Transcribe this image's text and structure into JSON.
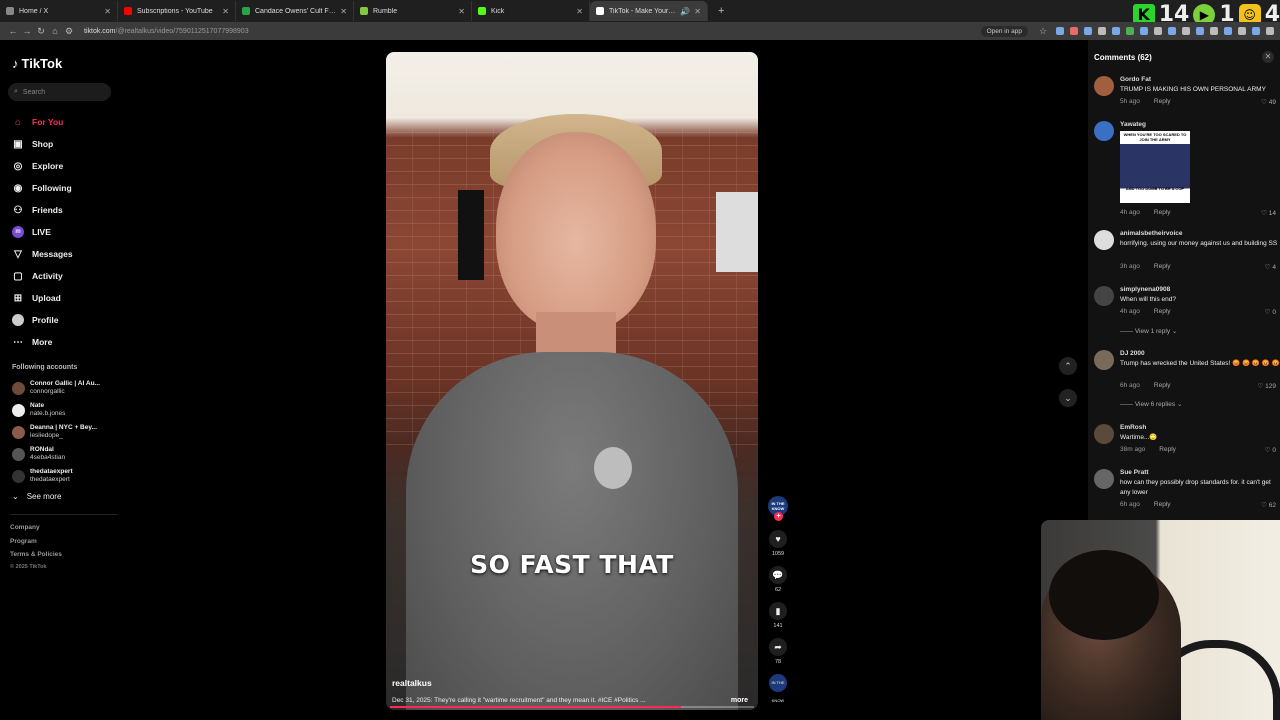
{
  "browser": {
    "tabs": [
      {
        "title": "Home / X",
        "color": "#888888"
      },
      {
        "title": "Subscriptions - YouTube",
        "color": "#ff0000"
      },
      {
        "title": "Candace Owens' Cult Followers",
        "color": "#2aa34a"
      },
      {
        "title": "Rumble",
        "color": "#85c742"
      },
      {
        "title": "Kick",
        "color": "#53fc18"
      },
      {
        "title": "TikTok - Make Your Day",
        "color": "#ffffff"
      }
    ],
    "url_host": "tiktok.com",
    "url_path": "/@realtalkus/video/7590112517077998903",
    "open_in_app": "Open in app",
    "overlay_numbers": [
      "14",
      "1",
      "4"
    ]
  },
  "sidebar": {
    "logo": "TikTok",
    "search_placeholder": "Search",
    "nav": [
      {
        "label": "For You",
        "icon": "home-icon",
        "glyph": "⌂"
      },
      {
        "label": "Shop",
        "icon": "shop-icon",
        "glyph": "▣"
      },
      {
        "label": "Explore",
        "icon": "explore-icon",
        "glyph": "◎"
      },
      {
        "label": "Following",
        "icon": "following-icon",
        "glyph": "◉"
      },
      {
        "label": "Friends",
        "icon": "friends-icon",
        "glyph": "⚇"
      },
      {
        "label": "LIVE",
        "icon": "live-icon",
        "glyph": "m"
      },
      {
        "label": "Messages",
        "icon": "messages-icon",
        "glyph": "▽"
      },
      {
        "label": "Activity",
        "icon": "activity-icon",
        "glyph": "▢"
      },
      {
        "label": "Upload",
        "icon": "upload-icon",
        "glyph": "⊞"
      },
      {
        "label": "Profile",
        "icon": "profile-icon",
        "glyph": ""
      },
      {
        "label": "More",
        "icon": "more-icon",
        "glyph": "⋯"
      }
    ],
    "following_title": "Following accounts",
    "following": [
      {
        "name": "Connor Gallic | AI Au...",
        "user": "connorgallic"
      },
      {
        "name": "Nate",
        "user": "nate.b.jones"
      },
      {
        "name": "Deanna | NYC + Bey...",
        "user": "lesliedope_"
      },
      {
        "name": "RONdal",
        "user": "4seba4stian"
      },
      {
        "name": "thedataexpert",
        "user": "thedataexpert"
      }
    ],
    "see_more": "See more",
    "footer": [
      "Company",
      "Program",
      "Terms & Policies",
      "© 2025 TikTok"
    ]
  },
  "video": {
    "caption": "SO FAST THAT",
    "author": "realtalkus",
    "description": "Dec 31, 2025: They're calling it \"wartime recruitment\" and they mean it. #ICE #Politics ...",
    "more": "more",
    "progress": 0.8
  },
  "rail": {
    "likes": "1059",
    "comments": "62",
    "saves": "141",
    "shares": "78"
  },
  "comments": {
    "header": "Comments (62)",
    "items": [
      {
        "name": "Gordo Fat",
        "text": "TRUMP IS MAKING HIS OWN PERSONAL ARMY",
        "time": "5h ago",
        "reply": "Reply",
        "likes": "49"
      },
      {
        "name": "Yawateg",
        "text": "",
        "time": "4h ago",
        "reply": "Reply",
        "likes": "14"
      },
      {
        "name": "animalsbetheirvoice",
        "text": "horrifying. using our money against us and building SS",
        "time": "3h ago",
        "reply": "Reply",
        "likes": "4"
      },
      {
        "name": "simplynena0908",
        "text": "When will this end?",
        "time": "4h ago",
        "reply": "Reply",
        "likes": "0",
        "view": "View 1 reply"
      },
      {
        "name": "DJ 2000",
        "text": "Trump has wrecked the United States! 😡 😡 😡 😡 😡",
        "time": "6h ago",
        "reply": "Reply",
        "likes": "129",
        "view": "View 6 replies"
      },
      {
        "name": "EmRosh",
        "text": "Wartime...🙄",
        "time": "38m ago",
        "reply": "Reply",
        "likes": "0"
      },
      {
        "name": "Sue Pratt",
        "text": "how can they possibly drop standards for. it can't get any lower",
        "time": "6h ago",
        "reply": "Reply",
        "likes": "62"
      }
    ],
    "meme_top": "WHEN YOU'RE TOO SCARED TO JOIN THE ARMY",
    "meme_bottom": "AND TOO DUMB TO BE A COP"
  }
}
